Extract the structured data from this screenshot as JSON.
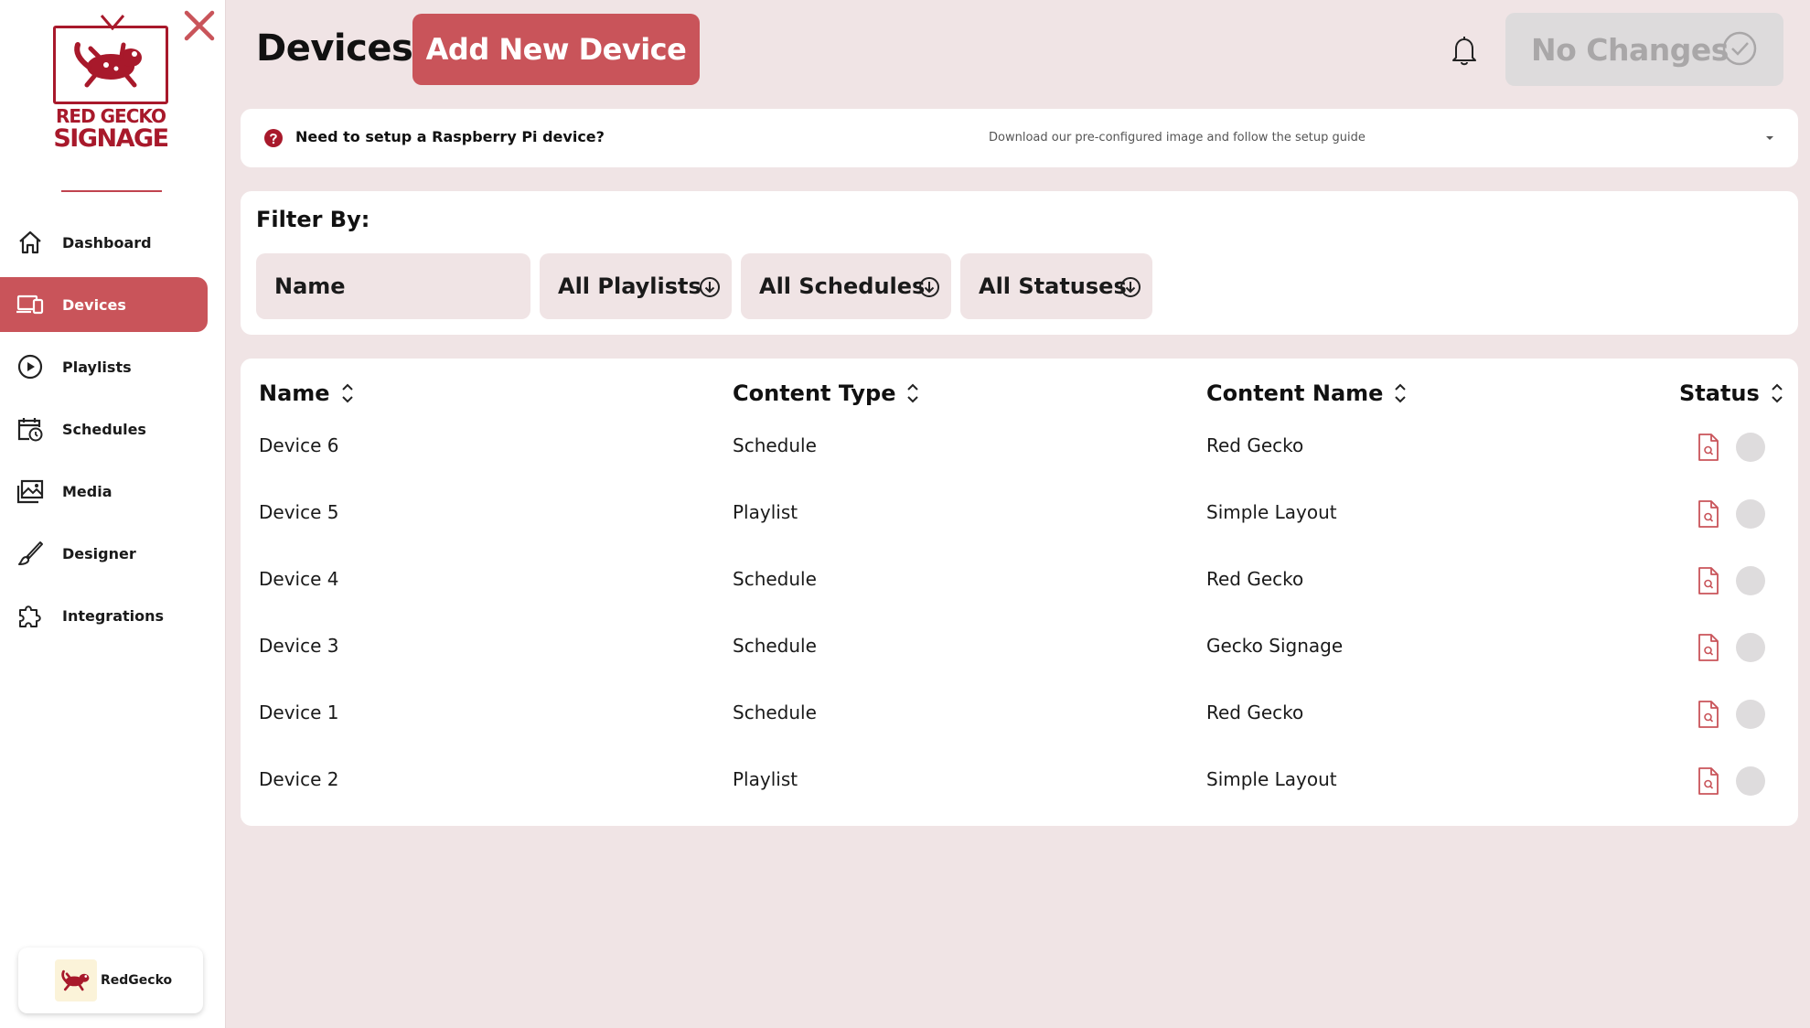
{
  "app": {
    "brand_line1": "RED GECKO",
    "brand_line2": "SIGNAGE",
    "accent_color": "#c9545a",
    "brand_color": "#a8192b"
  },
  "sidebar": {
    "items": [
      {
        "label": "Dashboard",
        "icon": "home-icon",
        "active": false
      },
      {
        "label": "Devices",
        "icon": "devices-icon",
        "active": true
      },
      {
        "label": "Playlists",
        "icon": "play-circle-icon",
        "active": false
      },
      {
        "label": "Schedules",
        "icon": "calendar-clock-icon",
        "active": false
      },
      {
        "label": "Media",
        "icon": "images-icon",
        "active": false
      },
      {
        "label": "Designer",
        "icon": "brush-icon",
        "active": false
      },
      {
        "label": "Integrations",
        "icon": "puzzle-icon",
        "active": false
      }
    ],
    "user": {
      "name": "RedGecko"
    }
  },
  "header": {
    "title": "Devices",
    "add_button": "Add New Device",
    "status_button": "No Changes"
  },
  "infobar": {
    "title": "Need to setup a Raspberry Pi device?",
    "subtitle": "Download our pre-configured image and follow the setup guide"
  },
  "filters": {
    "label": "Filter By:",
    "name_placeholder": "Name",
    "playlists": "All Playlists",
    "schedules": "All Schedules",
    "statuses": "All Statuses"
  },
  "table": {
    "columns": [
      "Name",
      "Content Type",
      "Content Name",
      "Status"
    ],
    "rows": [
      {
        "name": "Device 6",
        "type": "Schedule",
        "content": "Red Gecko"
      },
      {
        "name": "Device 5",
        "type": "Playlist",
        "content": "Simple Layout"
      },
      {
        "name": "Device 4",
        "type": "Schedule",
        "content": "Red Gecko"
      },
      {
        "name": "Device 3",
        "type": "Schedule",
        "content": "Gecko Signage"
      },
      {
        "name": "Device 1",
        "type": "Schedule",
        "content": "Red Gecko"
      },
      {
        "name": "Device 2",
        "type": "Playlist",
        "content": "Simple Layout"
      }
    ]
  }
}
